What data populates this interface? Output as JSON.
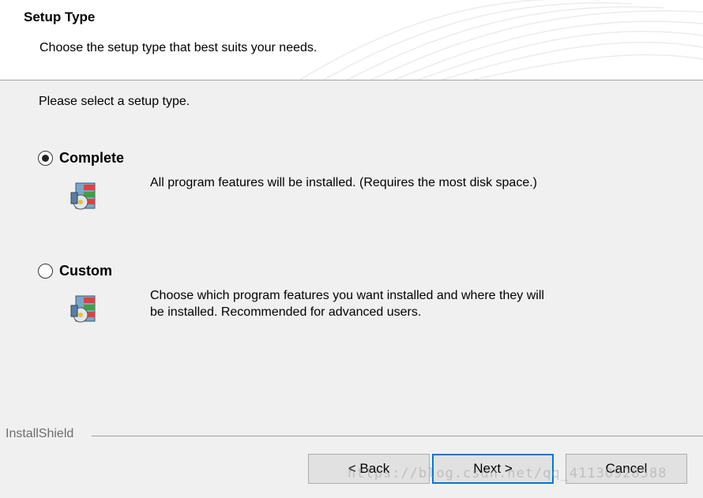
{
  "header": {
    "title": "Setup Type",
    "subtitle": "Choose the setup type that best suits your needs."
  },
  "prompt": "Please select a setup type.",
  "options": [
    {
      "label": "Complete",
      "selected": true,
      "description_lines": [
        "All program features will be installed. (Requires the most disk space.)"
      ]
    },
    {
      "label": "Custom",
      "selected": false,
      "description_lines": [
        "Choose which program features you want installed and where they will",
        "be installed. Recommended for advanced users."
      ]
    }
  ],
  "footer": {
    "brand": "InstallShield",
    "buttons": {
      "back": "< Back",
      "next": "Next >",
      "cancel": "Cancel"
    }
  },
  "watermark": "https://blog.csdn.net/qq_41130928588"
}
